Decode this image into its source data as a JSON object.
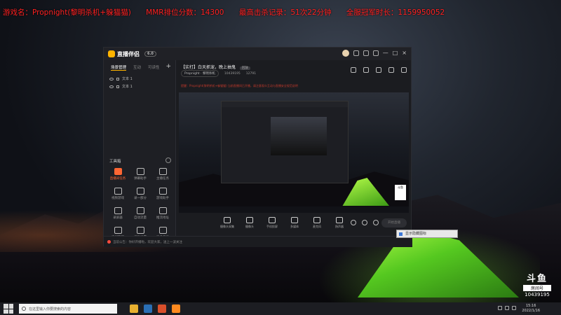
{
  "overlay": {
    "game": "游戏名：Propnight(黎明杀机+躲猫猫)",
    "mmr": "MMR排位分数：14300",
    "highest_kill": "最高击杀记录：51次22分钟",
    "total_fans": "全服冠军时长：1159950052"
  },
  "app": {
    "name": "直播伴侣",
    "version": "6.0",
    "window_controls": [
      "—",
      "□",
      "×"
    ]
  },
  "left_panel": {
    "tabs": [
      "场景管理",
      "互动",
      "可读性"
    ],
    "sources": [
      "文本 1",
      "文本 1"
    ],
    "tools_title": "工具箱",
    "tools": [
      {
        "label": "直播间任务",
        "icon": "task-icon",
        "hot": true
      },
      {
        "label": "弹幕助手",
        "icon": "danmaku-icon",
        "hot": false
      },
      {
        "label": "主播任务",
        "icon": "target-icon",
        "hot": false
      },
      {
        "label": "视频游戏",
        "icon": "game-icon",
        "hot": false
      },
      {
        "label": "录一部分",
        "icon": "download-icon",
        "hot": false
      },
      {
        "label": "游戏助手",
        "icon": "controller-icon",
        "hot": false
      },
      {
        "label": "录屏器",
        "icon": "record-icon",
        "hot": false
      },
      {
        "label": "自动流量",
        "icon": "flow-icon",
        "hot": false
      },
      {
        "label": "推流地址",
        "icon": "stream-icon",
        "hot": false
      },
      {
        "label": "房间管理",
        "icon": "room-icon",
        "hot": false
      },
      {
        "label": "红包设置",
        "icon": "gift-icon",
        "hot": false
      },
      {
        "label": "更多工具",
        "icon": "more-icon",
        "hot": false
      }
    ]
  },
  "room": {
    "title": "【实打】白天抓宠，晚上抽鬼",
    "tag": "回放",
    "game_chip": "Propnight · 黎明杀机",
    "viewers": "10439195",
    "hot": "12791",
    "notice": "提醒：Propnight(黎明杀机+躲猫猫) 当前直播间已开播，请注意观众互动与直播安全规范说明"
  },
  "controls": [
    {
      "label": "摄像头采集",
      "icon": "monitor-icon"
    },
    {
      "label": "摄像头",
      "icon": "camera-icon"
    },
    {
      "label": "手机投屏",
      "icon": "phone-icon"
    },
    {
      "label": "多媒体",
      "icon": "media-icon"
    },
    {
      "label": "麦克风",
      "icon": "mic-icon"
    },
    {
      "label": "扬声器",
      "icon": "speaker-icon"
    }
  ],
  "live_button": "开始直播",
  "status_text": "当前公告：你好开播啦，欢迎大家，送上一波关注",
  "tooltip": "显示隐藏图标",
  "douyu": {
    "logo": "斗鱼",
    "room_label": "房间号",
    "room_number": "10439195"
  },
  "taskbar": {
    "search_placeholder": "在这里输入你要搜索的内容",
    "time": "15:16",
    "date": "2022/1/16"
  },
  "colors": {
    "accent": "#ffb400",
    "overlay_text": "#ff2020",
    "tent_green": "#7dff2c"
  }
}
